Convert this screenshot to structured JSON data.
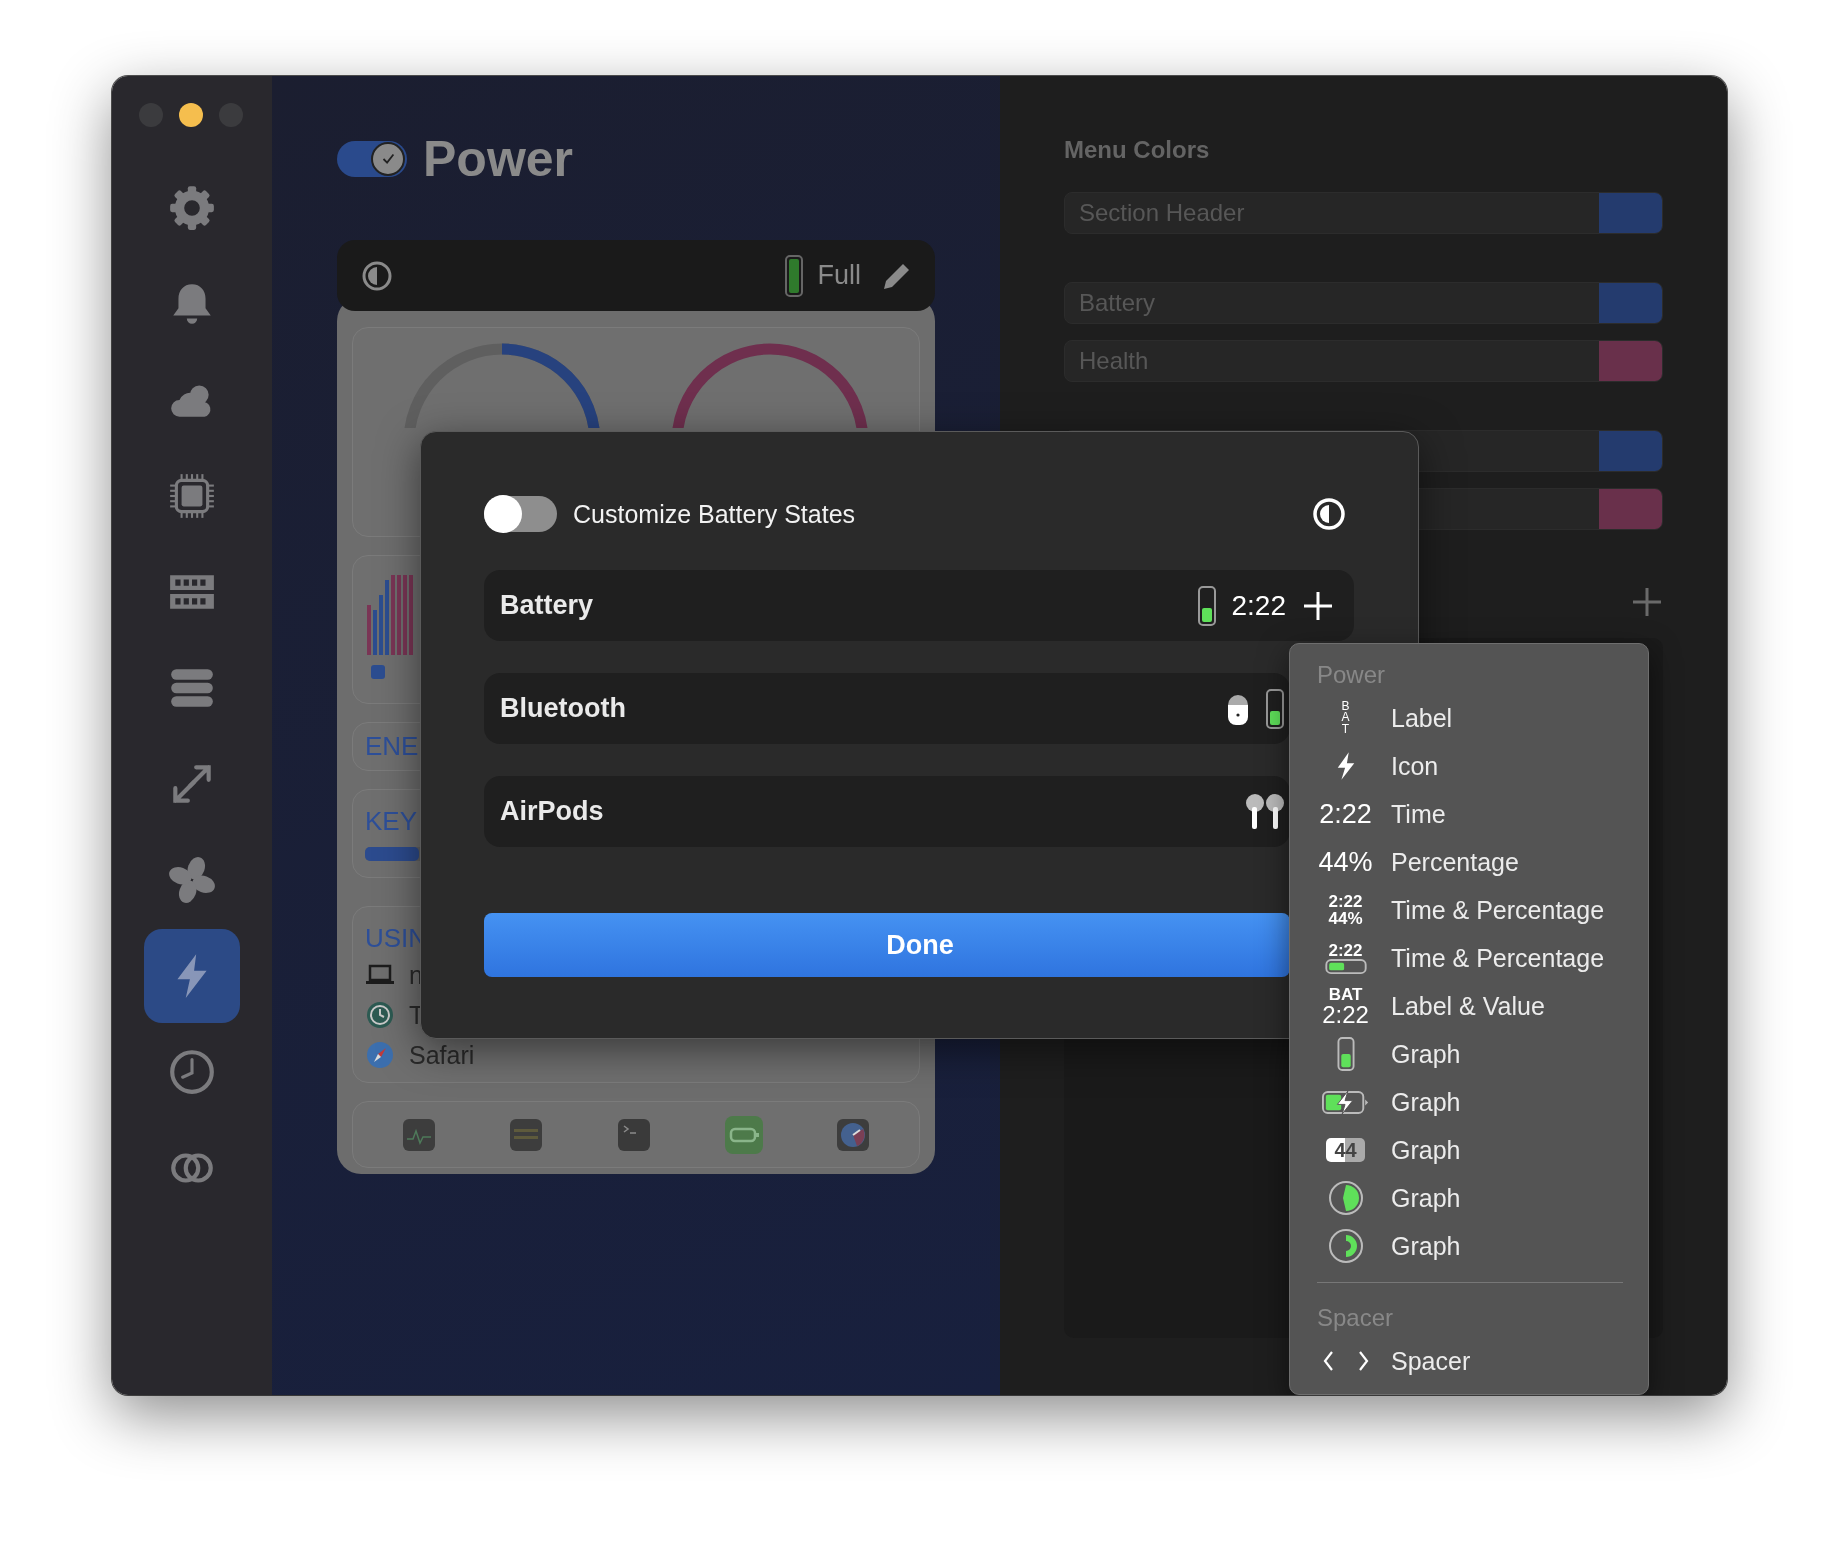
{
  "window": {
    "controls": [
      {
        "color": "#3b3b3e"
      },
      {
        "color": "#f5be4e"
      },
      {
        "color": "#3b3b3e"
      }
    ]
  },
  "sidebar": {
    "items": [
      {
        "kind": "gear",
        "selected": false
      },
      {
        "kind": "bell",
        "selected": false
      },
      {
        "kind": "cloud",
        "selected": false
      },
      {
        "kind": "chip",
        "selected": false
      },
      {
        "kind": "memory",
        "selected": false
      },
      {
        "kind": "disks",
        "selected": false
      },
      {
        "kind": "arrows",
        "selected": false
      },
      {
        "kind": "fan",
        "selected": false
      },
      {
        "kind": "bolt",
        "selected": true
      },
      {
        "kind": "clock",
        "selected": false
      },
      {
        "kind": "rings",
        "selected": false
      }
    ]
  },
  "module": {
    "title": "Power",
    "enabled": true
  },
  "toolbar": {
    "status": "Full"
  },
  "dashboard": {
    "energy_title": "ENE",
    "keyboard_title": "KEY",
    "keyboard_bar": {
      "level": 0.1
    },
    "usage_title": "USIN",
    "processes": [
      {
        "kind": "laptop",
        "name": "n"
      },
      {
        "kind": "clock",
        "name": "T"
      },
      {
        "kind": "compass",
        "name": "Safari"
      }
    ],
    "apps": [
      {
        "kind": "monitor"
      },
      {
        "kind": "console"
      },
      {
        "kind": "terminal"
      },
      {
        "kind": "battery"
      },
      {
        "kind": "gauge"
      }
    ]
  },
  "menu_colors": {
    "title": "Menu Colors",
    "groups": [
      {
        "rows": [
          {
            "label": "Section Header",
            "color": "#243b6e"
          }
        ]
      },
      {
        "rows": [
          {
            "label": "Battery",
            "color": "#243b6e"
          },
          {
            "label": "Health",
            "color": "#69304b"
          }
        ]
      },
      {
        "rows": [
          {
            "color": "#243b6e"
          },
          {
            "color": "#69304b"
          }
        ]
      }
    ]
  },
  "sheet": {
    "toggle": {
      "label": "Customize Battery States",
      "on": false
    },
    "rows": [
      {
        "kind": "battery",
        "label": "Battery",
        "value": "2:22"
      },
      {
        "kind": "bluetooth",
        "label": "Bluetooth"
      },
      {
        "kind": "airpods",
        "label": "AirPods"
      }
    ],
    "button": "Done"
  },
  "popup": {
    "sections": [
      {
        "title": "Power",
        "items": [
          {
            "kind": "vertical_label",
            "preview": "BAT",
            "label": "Label"
          },
          {
            "kind": "bolt",
            "label": "Icon"
          },
          {
            "kind": "text",
            "preview": "2:22",
            "label": "Time"
          },
          {
            "kind": "text",
            "preview": "44%",
            "label": "Percentage"
          },
          {
            "kind": "stacked",
            "preview": "2:22",
            "preview_2": "44%",
            "label": "Time & Percentage"
          },
          {
            "kind": "time_bar",
            "preview": "2:22",
            "label": "Time & Percentage"
          },
          {
            "kind": "stacked_small_top",
            "preview": "BAT",
            "preview_2": "2:22",
            "label": "Label & Value"
          },
          {
            "kind": "battery",
            "label": "Graph"
          },
          {
            "kind": "charging",
            "label": "Graph"
          },
          {
            "kind": "badge",
            "preview": "44",
            "label": "Graph"
          },
          {
            "kind": "pie",
            "label": "Graph"
          },
          {
            "kind": "ring",
            "label": "Graph"
          }
        ]
      },
      {
        "title": "Spacer",
        "items": [
          {
            "kind": "spacer",
            "label": "Spacer"
          }
        ]
      }
    ]
  }
}
